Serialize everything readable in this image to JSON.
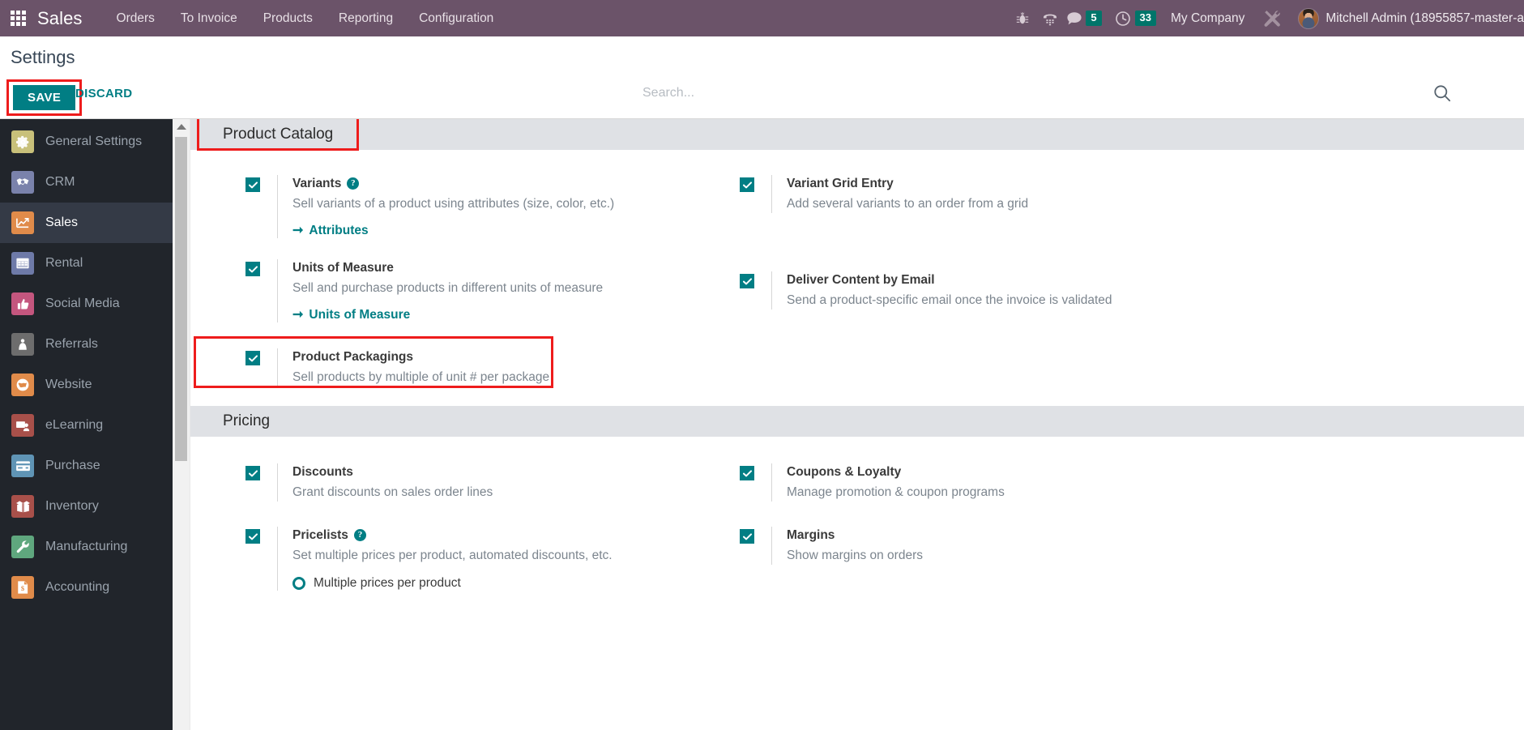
{
  "navbar": {
    "apps_icon": "apps-grid-icon",
    "brand": "Sales",
    "menu": [
      "Orders",
      "To Invoice",
      "Products",
      "Reporting",
      "Configuration"
    ],
    "icons": [
      {
        "name": "bug-icon",
        "glyph": "🐞"
      },
      {
        "name": "voip-phone-icon",
        "glyph": "☎"
      }
    ],
    "messages": {
      "icon": "chat-bubble-icon",
      "count": "5"
    },
    "activities": {
      "icon": "clock-icon",
      "count": "33"
    },
    "company": "My Company",
    "tools_icon": "tools-wrench-icon",
    "avatar": "user-avatar",
    "username": "Mitchell Admin (18955857-master-a"
  },
  "control": {
    "title": "Settings",
    "save_label": "SAVE",
    "discard_label": "DISCARD",
    "search_placeholder": "Search...",
    "search_value": "",
    "search_icon": "search-icon"
  },
  "sidebar": {
    "items": [
      {
        "label": "General Settings",
        "icon": "gear-icon",
        "color": "#c8c07a",
        "active": false
      },
      {
        "label": "CRM",
        "icon": "handshake-icon",
        "color": "#7a82ab",
        "active": false
      },
      {
        "label": "Sales",
        "icon": "chart-growth-icon",
        "color": "#e08b4a",
        "active": true
      },
      {
        "label": "Rental",
        "icon": "calendar-icon",
        "color": "#6e7aa8",
        "active": false
      },
      {
        "label": "Social Media",
        "icon": "thumbs-up-icon",
        "color": "#c4567e",
        "active": false
      },
      {
        "label": "Referrals",
        "icon": "gift-person-icon",
        "color": "#6d6d6d",
        "active": false
      },
      {
        "label": "Website",
        "icon": "globe-icon",
        "color": "#e08b4a",
        "active": false
      },
      {
        "label": "eLearning",
        "icon": "presentation-icon",
        "color": "#a8504a",
        "active": false
      },
      {
        "label": "Purchase",
        "icon": "credit-card-icon",
        "color": "#5f94b5",
        "active": false
      },
      {
        "label": "Inventory",
        "icon": "open-box-icon",
        "color": "#a8504a",
        "active": false
      },
      {
        "label": "Manufacturing",
        "icon": "wrench-icon",
        "color": "#5fa77e",
        "active": false
      },
      {
        "label": "Accounting",
        "icon": "invoice-dollar-icon",
        "color": "#e08b4a",
        "active": false
      }
    ]
  },
  "sections": [
    {
      "name": "product-catalog",
      "title": "Product Catalog",
      "highlighted": true,
      "left": [
        {
          "name": "variants",
          "title": "Variants",
          "desc": "Sell variants of a product using attributes (size, color, etc.)",
          "checked": true,
          "help": true,
          "link": "Attributes"
        },
        {
          "name": "units-of-measure",
          "title": "Units of Measure",
          "desc": "Sell and purchase products in different units of measure",
          "checked": true,
          "help": false,
          "link": "Units of Measure"
        },
        {
          "name": "product-packagings",
          "title": "Product Packagings",
          "desc": "Sell products by multiple of unit # per package",
          "checked": true,
          "help": false,
          "highlighted": true
        }
      ],
      "right": [
        {
          "name": "variant-grid-entry",
          "title": "Variant Grid Entry",
          "desc": "Add several variants to an order from a grid",
          "checked": true,
          "help": false
        },
        {
          "name": "deliver-content-by-email",
          "title": "Deliver Content by Email",
          "desc": "Send a product-specific email once the invoice is validated",
          "checked": true,
          "help": false
        }
      ]
    },
    {
      "name": "pricing",
      "title": "Pricing",
      "highlighted": false,
      "left": [
        {
          "name": "discounts",
          "title": "Discounts",
          "desc": "Grant discounts on sales order lines",
          "checked": true,
          "help": false
        },
        {
          "name": "pricelists",
          "title": "Pricelists",
          "desc": "Set multiple prices per product, automated discounts, etc.",
          "checked": true,
          "help": true,
          "radio": "Multiple prices per product"
        }
      ],
      "right": [
        {
          "name": "coupons-and-loyalty",
          "title": "Coupons & Loyalty",
          "desc": "Manage promotion & coupon programs",
          "checked": true,
          "help": false
        },
        {
          "name": "margins",
          "title": "Margins",
          "desc": "Show margins on orders",
          "checked": true,
          "help": false
        }
      ]
    }
  ],
  "colors": {
    "navbar": "#6b5369",
    "accent": "#017e84",
    "highlight": "#ee1c1c",
    "sidebar": "#21252b",
    "section_header": "#dfe1e5"
  }
}
